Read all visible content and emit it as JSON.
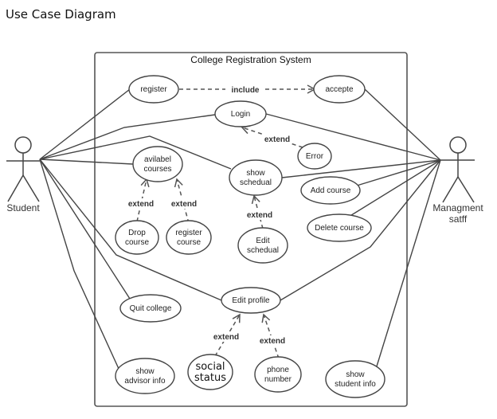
{
  "page_title": "Use Case Diagram",
  "system": {
    "title": "College Registration System"
  },
  "actors": {
    "student": {
      "label": "Student"
    },
    "staff": {
      "label_line1": "Managment",
      "label_line2": "satff"
    }
  },
  "use_cases": {
    "register": {
      "lines": [
        "register"
      ]
    },
    "accepte": {
      "lines": [
        "accepte"
      ]
    },
    "login": {
      "lines": [
        "Login"
      ]
    },
    "error": {
      "lines": [
        "Error"
      ]
    },
    "available_courses": {
      "lines": [
        "avilabel",
        "courses"
      ]
    },
    "show_schedule": {
      "lines": [
        "show",
        "schedual"
      ]
    },
    "add_course": {
      "lines": [
        "Add course"
      ]
    },
    "delete_course": {
      "lines": [
        "Delete course"
      ]
    },
    "drop_course": {
      "lines": [
        "Drop",
        "course"
      ]
    },
    "register_course": {
      "lines": [
        "register",
        "course"
      ]
    },
    "edit_schedule": {
      "lines": [
        "Edit",
        "schedual"
      ]
    },
    "quit_college": {
      "lines": [
        "Quit college"
      ]
    },
    "edit_profile": {
      "lines": [
        "Edit profile"
      ]
    },
    "social_status": {
      "lines": [
        "social",
        "status"
      ]
    },
    "phone_number": {
      "lines": [
        "phone",
        "number"
      ]
    },
    "show_advisor_info": {
      "lines": [
        "show",
        "advisor info"
      ]
    },
    "show_student_info": {
      "lines": [
        "show",
        "student info"
      ]
    }
  },
  "relations": {
    "include_label": "include",
    "extend_label": "extend"
  }
}
